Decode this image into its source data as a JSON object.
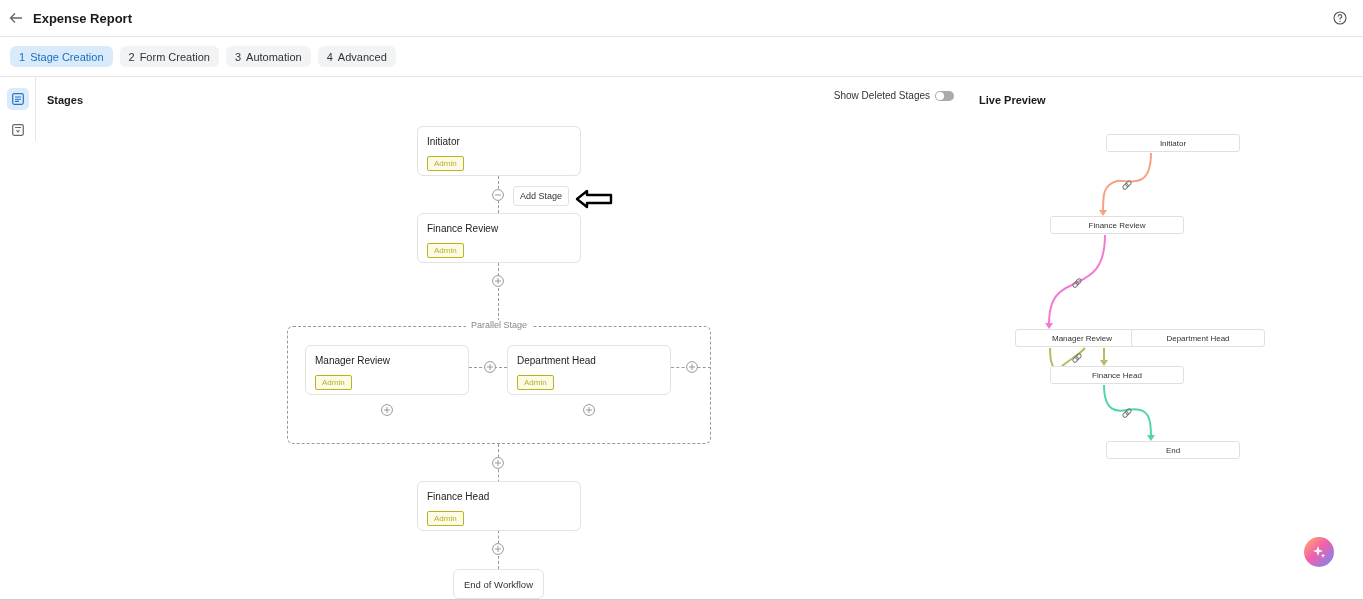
{
  "header": {
    "title": "Expense Report"
  },
  "tabs": [
    {
      "number": "1",
      "label": "Stage Creation",
      "selected": true
    },
    {
      "number": "2",
      "label": "Form Creation",
      "selected": false
    },
    {
      "number": "3",
      "label": "Automation",
      "selected": false
    },
    {
      "number": "4",
      "label": "Advanced",
      "selected": false
    }
  ],
  "rail": [
    {
      "kind": "list",
      "selected": true
    },
    {
      "kind": "form",
      "selected": false
    }
  ],
  "stages_panel": {
    "title": "Stages",
    "toggle": {
      "label": "Show Deleted Stages",
      "on": false
    },
    "add_stage_button": "Add Stage",
    "stages": [
      {
        "kind": "stage",
        "name": "Initiator",
        "role": "Admin"
      },
      {
        "kind": "stage",
        "name": "Finance Review",
        "role": "Admin"
      },
      {
        "kind": "parallel",
        "label": "Parallel Stage",
        "stages": [
          {
            "name": "Manager Review",
            "role": "Admin"
          },
          {
            "name": "Department Head",
            "role": "Admin"
          }
        ]
      },
      {
        "kind": "stage",
        "name": "Finance Head",
        "role": "Admin"
      },
      {
        "kind": "end",
        "name": "End of Workflow"
      }
    ]
  },
  "preview": {
    "title": "Live Preview",
    "nodes": [
      "Initiator",
      "Finance Review",
      "Manager Review",
      "Department Head",
      "Finance Head",
      "End"
    ],
    "edges": [
      {
        "color": "#f5a284"
      },
      {
        "color": "#f27ad2"
      },
      {
        "color": "#b9ba62"
      },
      {
        "color": "#55d2b0"
      }
    ]
  }
}
